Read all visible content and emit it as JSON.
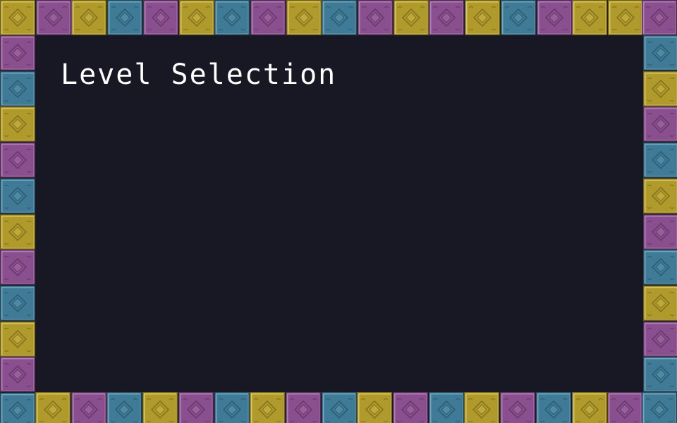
{
  "screen": {
    "title": "Level Selection"
  },
  "frame": {
    "tile_icon": "diamond-block-icon",
    "colors": {
      "gold": {
        "base": "#b19a2c",
        "light": "#dcc758",
        "dark": "#6e5f16",
        "mark": "#86751f"
      },
      "purple": {
        "base": "#8a4f8e",
        "light": "#b57db9",
        "dark": "#4f2a52",
        "mark": "#683b6c"
      },
      "teal": {
        "base": "#3f7b96",
        "light": "#6ea7c1",
        "dark": "#22475a",
        "mark": "#2f5e74"
      }
    },
    "top": [
      "gold",
      "purple",
      "gold",
      "teal",
      "purple",
      "gold",
      "teal",
      "purple",
      "gold",
      "teal",
      "purple",
      "gold",
      "purple",
      "gold",
      "teal",
      "purple",
      "gold",
      "gold",
      "purple"
    ],
    "left": [
      "purple",
      "teal",
      "gold",
      "purple",
      "teal",
      "gold",
      "purple",
      "teal",
      "gold",
      "purple",
      "teal"
    ],
    "right": [
      "teal",
      "gold",
      "purple",
      "teal",
      "gold",
      "purple",
      "teal",
      "gold",
      "purple",
      "teal"
    ],
    "bottom": [
      "gold",
      "purple",
      "teal",
      "gold",
      "purple",
      "teal",
      "gold",
      "purple",
      "teal",
      "gold",
      "purple",
      "teal",
      "gold",
      "purple",
      "teal",
      "gold",
      "purple",
      "teal"
    ]
  },
  "background_color": "#181824",
  "text_color": "#ffffff"
}
